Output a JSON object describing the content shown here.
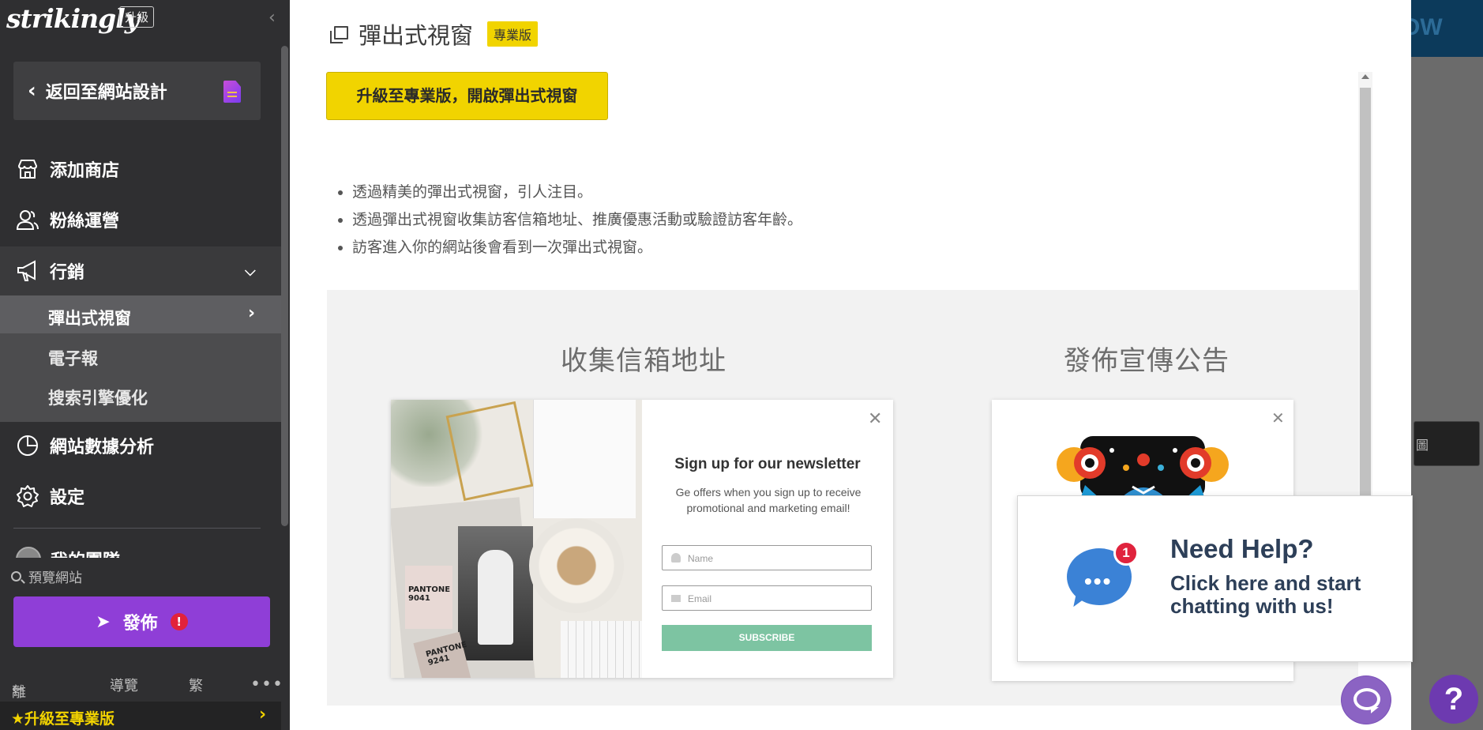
{
  "sidebar": {
    "logo": "strikingly",
    "upgrade_badge": "升級",
    "back_label": "返回至網站設計",
    "nav": {
      "shop": "添加商店",
      "fans": "粉絲運營",
      "marketing": "行銷",
      "marketing_sub": [
        "彈出式視窗",
        "電子報",
        "搜索引擎優化"
      ],
      "analytics": "網站數據分析",
      "settings": "設定",
      "team": "我的團隊"
    },
    "preview_label": "預覽網站",
    "publish_label": "發佈",
    "publish_alert": "!",
    "bottom": {
      "leave": "離開",
      "guide": "導覽",
      "lang": "繁",
      "more": "•••"
    },
    "promo": "★升級至專業版"
  },
  "background": {
    "button_fragment": "OW",
    "tooltip_fragment": "圖",
    "help_q": "?"
  },
  "modal": {
    "title": "彈出式視窗",
    "pro_tag": "專業版",
    "upgrade_button": "升級至專業版，開啟彈出式視窗",
    "bullets": [
      "透過精美的彈出式視窗，引人注目。",
      "透過彈出式視窗收集訪客信箱地址、推廣優惠活動或驗證訪客年齡。",
      "訪客進入你的網站後會看到一次彈出式視窗。"
    ],
    "examples": {
      "email_title": "收集信箱地址",
      "announce_title": "發佈宣傳公告"
    },
    "newsletter": {
      "title": "Sign up for our newsletter",
      "subtitle": "Ge offers when you sign up to receive promotional and marketing email!",
      "name_placeholder": "Name",
      "email_placeholder": "Email",
      "subscribe": "SUBSCRIBE",
      "swatch_1": "PANTONE 9041",
      "swatch_2": "PANTONE 9241"
    }
  },
  "chat": {
    "badge": "1",
    "dots": "•••",
    "heading": "Need Help?",
    "subtext": "Click here and start chatting with us!"
  },
  "colors": {
    "sidebar_bg": "#2f2f31",
    "publish": "#8f3ed7",
    "pro_yellow": "#f1d400",
    "subscribe_green": "#7dc4a2",
    "chat_blue": "#3b82d6"
  }
}
